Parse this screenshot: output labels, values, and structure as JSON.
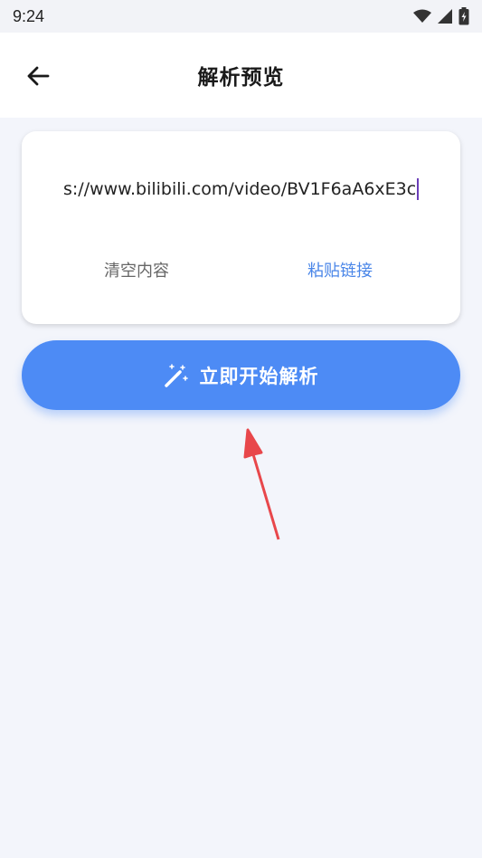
{
  "status_bar": {
    "time": "9:24",
    "icons": [
      "wifi-icon",
      "signal-icon",
      "battery-charging-icon"
    ]
  },
  "header": {
    "title": "解析预览",
    "back_icon": "arrow-left-icon"
  },
  "input_card": {
    "url_value": "s://www.bilibili.com/video/BV1F6aA6xE3c",
    "clear_label": "清空内容",
    "paste_label": "粘贴链接"
  },
  "parse_button": {
    "label": "立即开始解析",
    "icon": "magic-wand-icon"
  },
  "annotation": {
    "arrow_color": "#e8474b"
  },
  "colors": {
    "accent": "#4d8bf5",
    "link": "#4a86e8",
    "background": "#f3f5fb"
  }
}
